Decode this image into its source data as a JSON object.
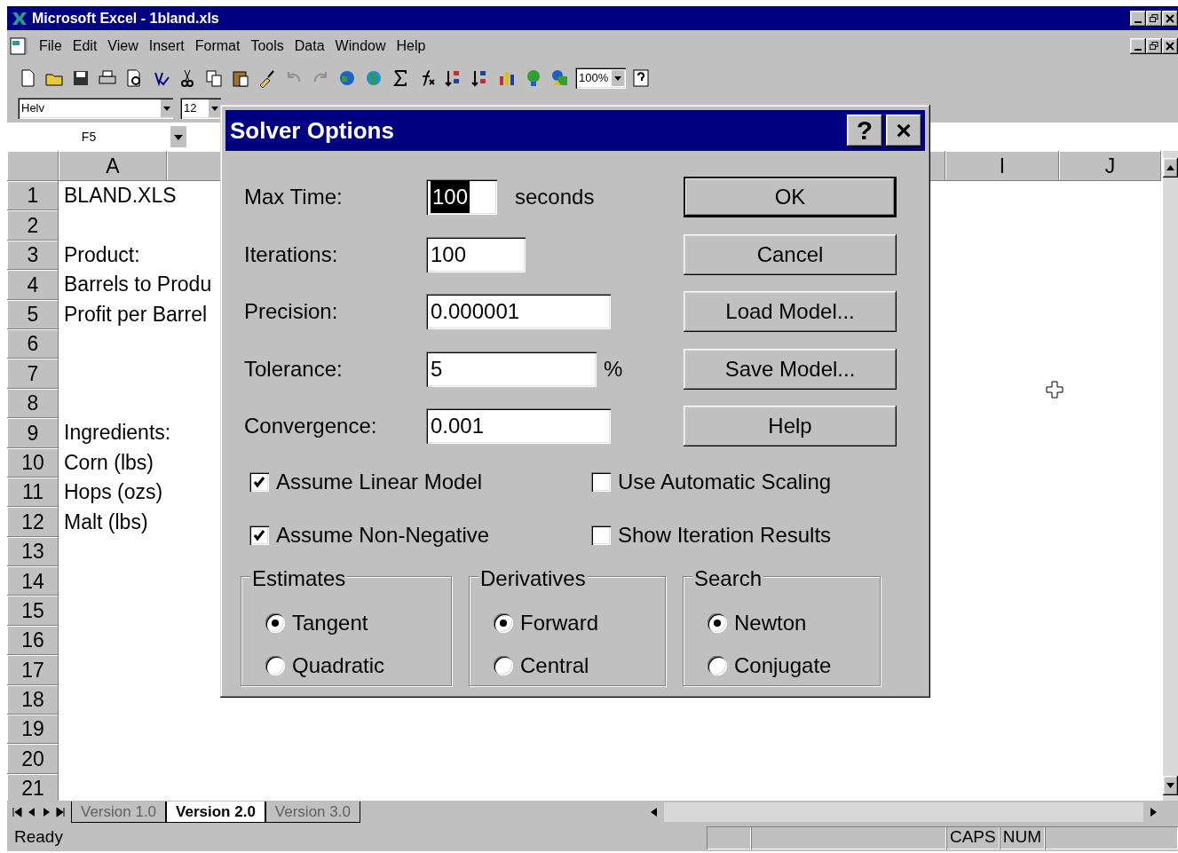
{
  "window": {
    "title": "Microsoft Excel - 1bland.xls"
  },
  "menu": [
    {
      "label": "File"
    },
    {
      "label": "Edit"
    },
    {
      "label": "View"
    },
    {
      "label": "Insert"
    },
    {
      "label": "Format"
    },
    {
      "label": "Tools"
    },
    {
      "label": "Data"
    },
    {
      "label": "Window"
    },
    {
      "label": "Help"
    }
  ],
  "toolbar": {
    "zoom": "100%"
  },
  "format_toolbar": {
    "font": "Helv",
    "size": "12"
  },
  "name_box": "F5",
  "sheet": {
    "column_headers": [
      "A",
      "I",
      "J"
    ],
    "rows": [
      {
        "number": "1",
        "a": "BLAND.XLS"
      },
      {
        "number": "2"
      },
      {
        "number": "3",
        "a": "Product:"
      },
      {
        "number": "4",
        "a": "Barrels to Produ"
      },
      {
        "number": "5",
        "a": "Profit per Barrel"
      },
      {
        "number": "6"
      },
      {
        "number": "7"
      },
      {
        "number": "8"
      },
      {
        "number": "9",
        "a": "Ingredients:"
      },
      {
        "number": "10",
        "a": "Corn (lbs)"
      },
      {
        "number": "11",
        "a": "Hops (ozs)"
      },
      {
        "number": "12",
        "a": "Malt (lbs)"
      },
      {
        "number": "13"
      },
      {
        "number": "14"
      },
      {
        "number": "15"
      },
      {
        "number": "16"
      },
      {
        "number": "17"
      },
      {
        "number": "18"
      },
      {
        "number": "19"
      },
      {
        "number": "20"
      },
      {
        "number": "21"
      }
    ]
  },
  "sheet_tabs": [
    {
      "label": "Version 1.0",
      "selected": false
    },
    {
      "label": "Version 2.0",
      "selected": true
    },
    {
      "label": "Version 3.0",
      "selected": false
    }
  ],
  "status_bar": {
    "text": "Ready",
    "indicators": [
      "CAPS",
      "NUM"
    ]
  },
  "dialog": {
    "title": "Solver Options",
    "title_buttons": [
      "?",
      "×"
    ],
    "fields": [
      {
        "label": "Max Time:",
        "value": "100",
        "unit": "seconds",
        "selected": true
      },
      {
        "label": "Iterations:",
        "value": "100",
        "selected": false
      },
      {
        "label": "Precision:",
        "value": "0.000001",
        "selected": false
      },
      {
        "label": "Tolerance:",
        "value": "5",
        "unit": "%",
        "selected": false
      },
      {
        "label": "Convergence:",
        "value": "0.001",
        "selected": false
      }
    ],
    "buttons": [
      {
        "label": "OK",
        "default": true
      },
      {
        "label": "Cancel",
        "default": false
      },
      {
        "label": "Load Model...",
        "default": false
      },
      {
        "label": "Save Model...",
        "default": false
      },
      {
        "label": "Help",
        "default": false
      }
    ],
    "checkboxes": [
      {
        "label": "Assume Linear Model",
        "checked": true
      },
      {
        "label": "Use Automatic Scaling",
        "checked": false
      },
      {
        "label": "Assume Non-Negative",
        "checked": true
      },
      {
        "label": "Show Iteration Results",
        "checked": false
      }
    ],
    "groups": [
      {
        "title": "Estimates",
        "options": [
          {
            "label": "Tangent",
            "selected": true
          },
          {
            "label": "Quadratic",
            "selected": false
          }
        ]
      },
      {
        "title": "Derivatives",
        "options": [
          {
            "label": "Forward",
            "selected": true
          },
          {
            "label": "Central",
            "selected": false
          }
        ]
      },
      {
        "title": "Search",
        "options": [
          {
            "label": "Newton",
            "selected": true
          },
          {
            "label": "Conjugate",
            "selected": false
          }
        ]
      }
    ]
  }
}
